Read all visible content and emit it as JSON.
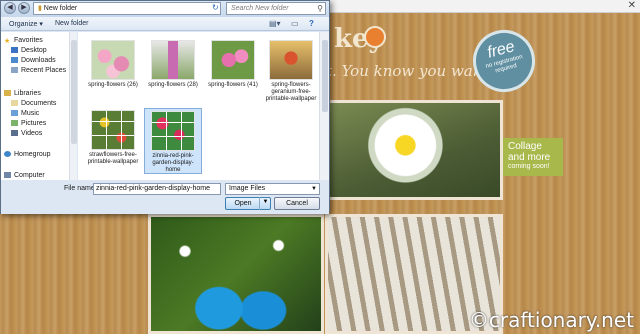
{
  "dialog": {
    "address": "New folder",
    "search_placeholder": "Search New folder",
    "toolbar": {
      "organize": "Organize ▾",
      "new_folder": "New folder"
    },
    "nav": {
      "favorites": "Favorites",
      "desktop": "Desktop",
      "downloads": "Downloads",
      "recent_places": "Recent Places",
      "libraries": "Libraries",
      "documents": "Documents",
      "music": "Music",
      "pictures": "Pictures",
      "videos": "Videos",
      "homegroup": "Homegroup",
      "computer": "Computer"
    },
    "files": [
      {
        "name": "spring-flowers (26)"
      },
      {
        "name": "spring-flowers (28)"
      },
      {
        "name": "spring-flowers (41)"
      },
      {
        "name": "spring-flowers-geranium-free-printable-wallpaper"
      },
      {
        "name": "strawflowers-free-printable-wallpaper"
      },
      {
        "name": "zinnia-red-pink-garden-display-home"
      }
    ],
    "file_name_label": "File name:",
    "file_name_value": "zinnia-red-pink-garden-display-home",
    "file_type": "Image Files",
    "open_label": "Open",
    "cancel_label": "Cancel"
  },
  "site": {
    "brand": "key",
    "tagline": "t. You know you want it.",
    "badge_main": "free",
    "badge_sub": "no registration required",
    "collage_title": "Collage and more",
    "collage_sub": "coming soon!",
    "watermark": "©craftionary.net"
  }
}
